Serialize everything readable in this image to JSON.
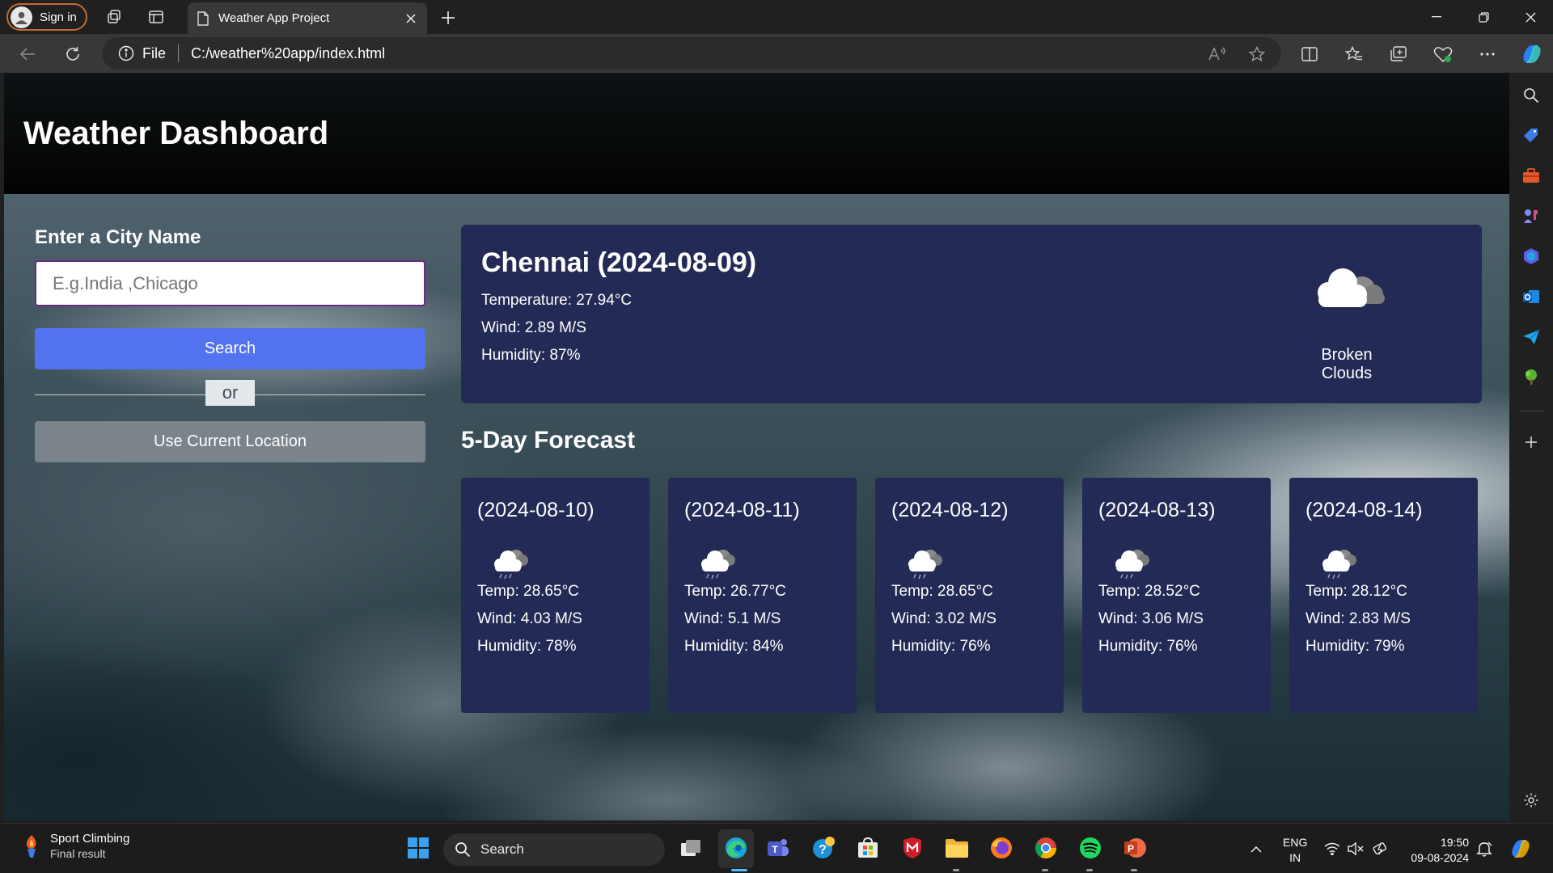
{
  "browser": {
    "signin_label": "Sign in",
    "tab_title": "Weather App Project",
    "url_scheme": "File",
    "url": "C:/weather%20app/index.html"
  },
  "app": {
    "title": "Weather Dashboard",
    "city_label": "Enter a City Name",
    "input_placeholder": "E.g.India ,Chicago",
    "search_label": "Search",
    "or_label": "or",
    "location_label": "Use Current Location",
    "current": {
      "title": "Chennai (2024-08-09)",
      "temperature": "Temperature: 27.94°C",
      "wind": "Wind: 2.89 M/S",
      "humidity": "Humidity: 87%",
      "description": "Broken Clouds",
      "icon": "broken-clouds-icon"
    },
    "forecast_heading": "5-Day Forecast",
    "forecast": [
      {
        "date": "(2024-08-10)",
        "temp": "Temp: 28.65°C",
        "wind": "Wind: 4.03 M/S",
        "humidity": "Humidity: 78%",
        "icon": "rain-cloud-icon"
      },
      {
        "date": "(2024-08-11)",
        "temp": "Temp: 26.77°C",
        "wind": "Wind: 5.1 M/S",
        "humidity": "Humidity: 84%",
        "icon": "rain-cloud-icon"
      },
      {
        "date": "(2024-08-12)",
        "temp": "Temp: 28.65°C",
        "wind": "Wind: 3.02 M/S",
        "humidity": "Humidity: 76%",
        "icon": "rain-cloud-icon"
      },
      {
        "date": "(2024-08-13)",
        "temp": "Temp: 28.52°C",
        "wind": "Wind: 3.06 M/S",
        "humidity": "Humidity: 76%",
        "icon": "rain-cloud-icon"
      },
      {
        "date": "(2024-08-14)",
        "temp": "Temp: 28.12°C",
        "wind": "Wind: 2.83 M/S",
        "humidity": "Humidity: 79%",
        "icon": "rain-cloud-icon"
      }
    ]
  },
  "taskbar": {
    "widget_title": "Sport Climbing",
    "widget_subtitle": "Final result",
    "search_label": "Search",
    "lang_line1": "ENG",
    "lang_line2": "IN",
    "time": "19:50",
    "date": "09-08-2024"
  },
  "colors": {
    "card_bg": "#232a55",
    "search_button": "#5372ef",
    "location_button": "#7a848a",
    "header_bg": "#070909"
  }
}
